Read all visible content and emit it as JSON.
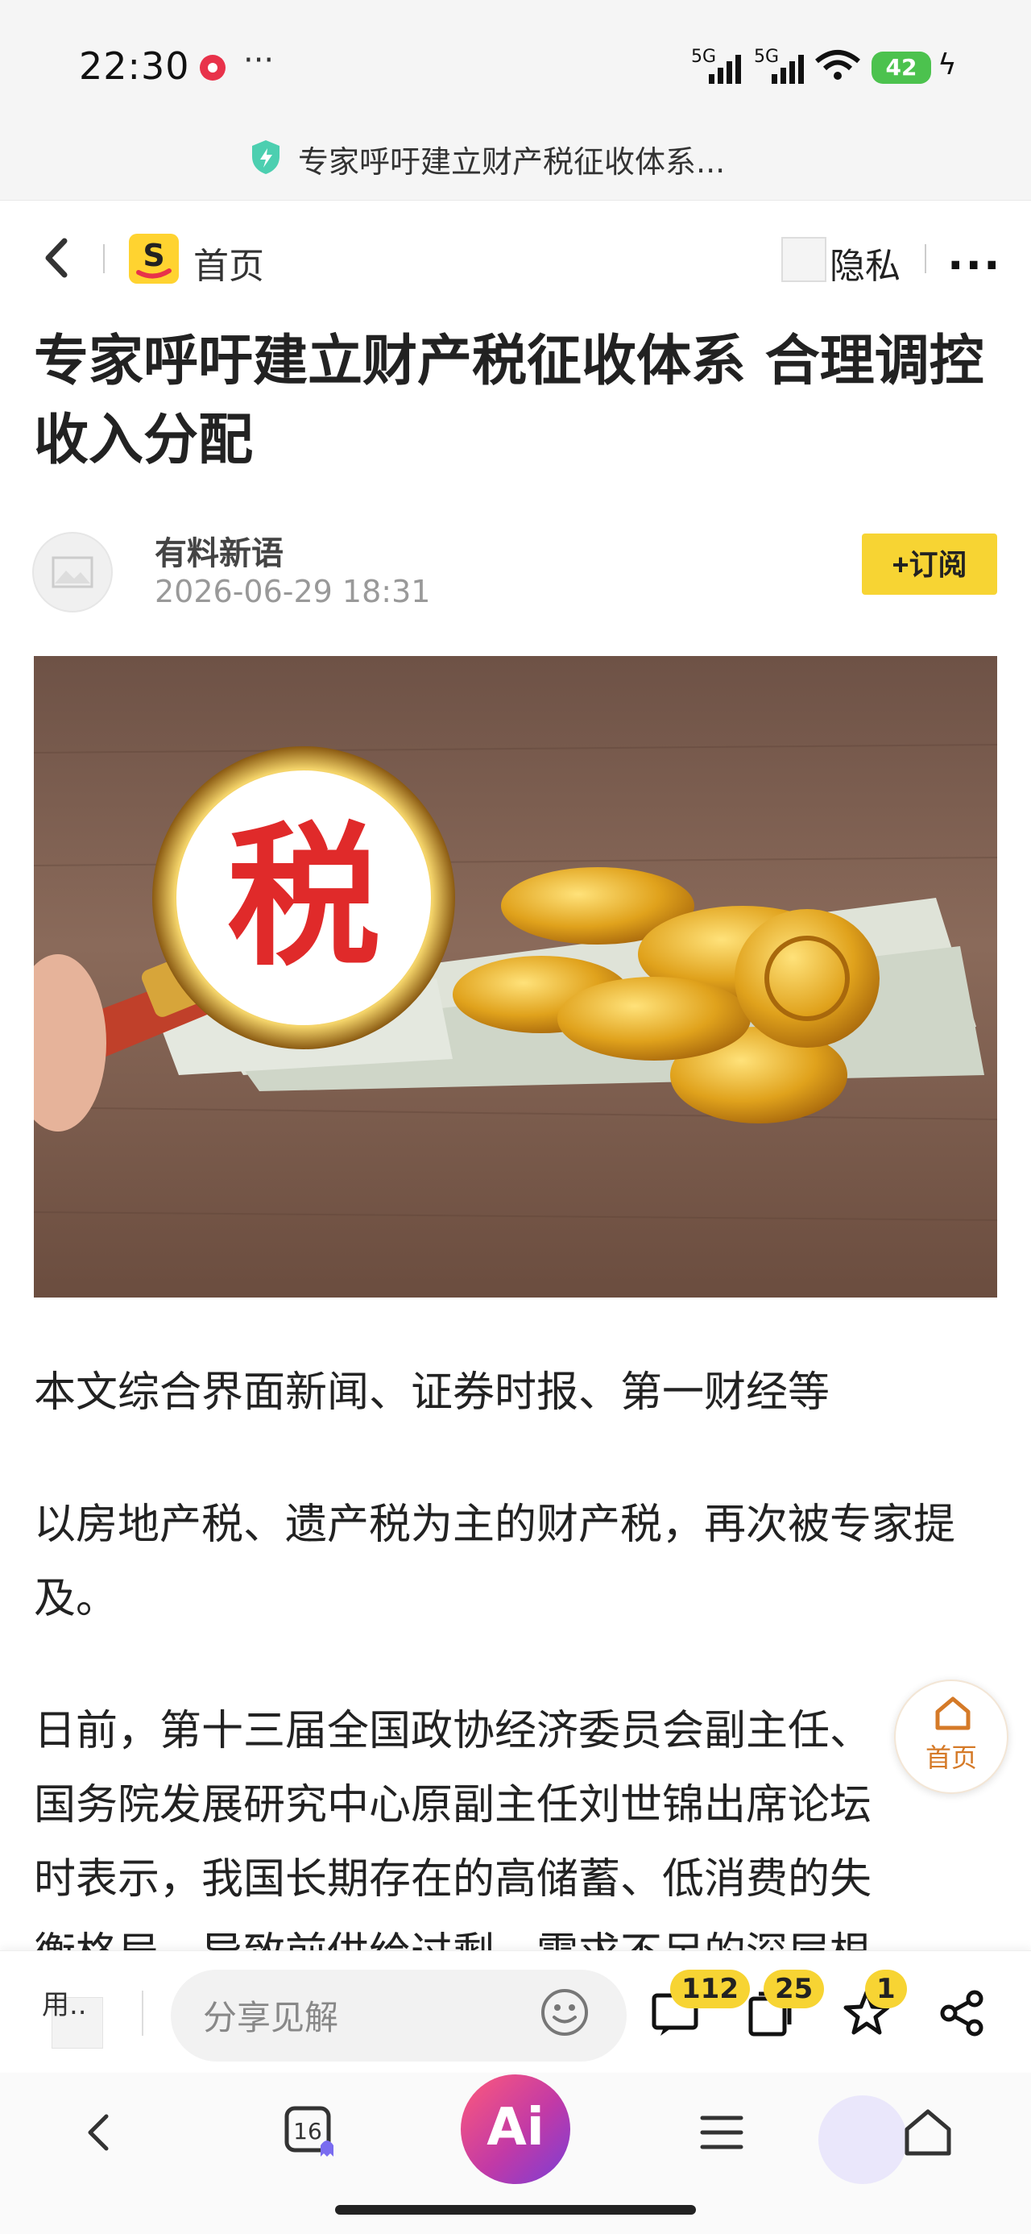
{
  "status_bar": {
    "time": "22:30",
    "more": "···",
    "signal_1": "5G",
    "signal_2": "5G",
    "battery": "42"
  },
  "url_bar": {
    "text": "专家呼吁建立财产税征收体系..."
  },
  "nav": {
    "home_label": "首页",
    "logo_letter": "S",
    "privacy_label": "隐私",
    "more": "···"
  },
  "article": {
    "title": "专家呼吁建立财产税征收体系 合理调控收入分配",
    "author": "有料新语",
    "date": "2026-06-29 18:31",
    "subscribe_label": "+订阅",
    "hero_char": "税",
    "paragraphs": [
      "本文综合界面新闻、证券时报、第一财经等",
      "以房地产税、遗产税为主的财产税，再次被专家提及。",
      "日前，第十三届全国政协经济委员会副主任、国务院发展研究中心原副主任刘世锦出席论坛时表示，我国长期存在的高储蓄、低消费的失衡格局，导致前供给过剩、需求不足的深层根"
    ]
  },
  "float_home": {
    "label": "首页"
  },
  "comment_bar": {
    "user_label": "用..",
    "placeholder": "分享见解",
    "comments_count": "112",
    "shares_count": "25",
    "favorites_count": "1"
  },
  "bottom_nav": {
    "tabs_count": "16",
    "ai_label": "Ai"
  },
  "colors": {
    "accent": "#f7d433",
    "brand_red": "#e8324a",
    "battery_green": "#4cc24e"
  }
}
